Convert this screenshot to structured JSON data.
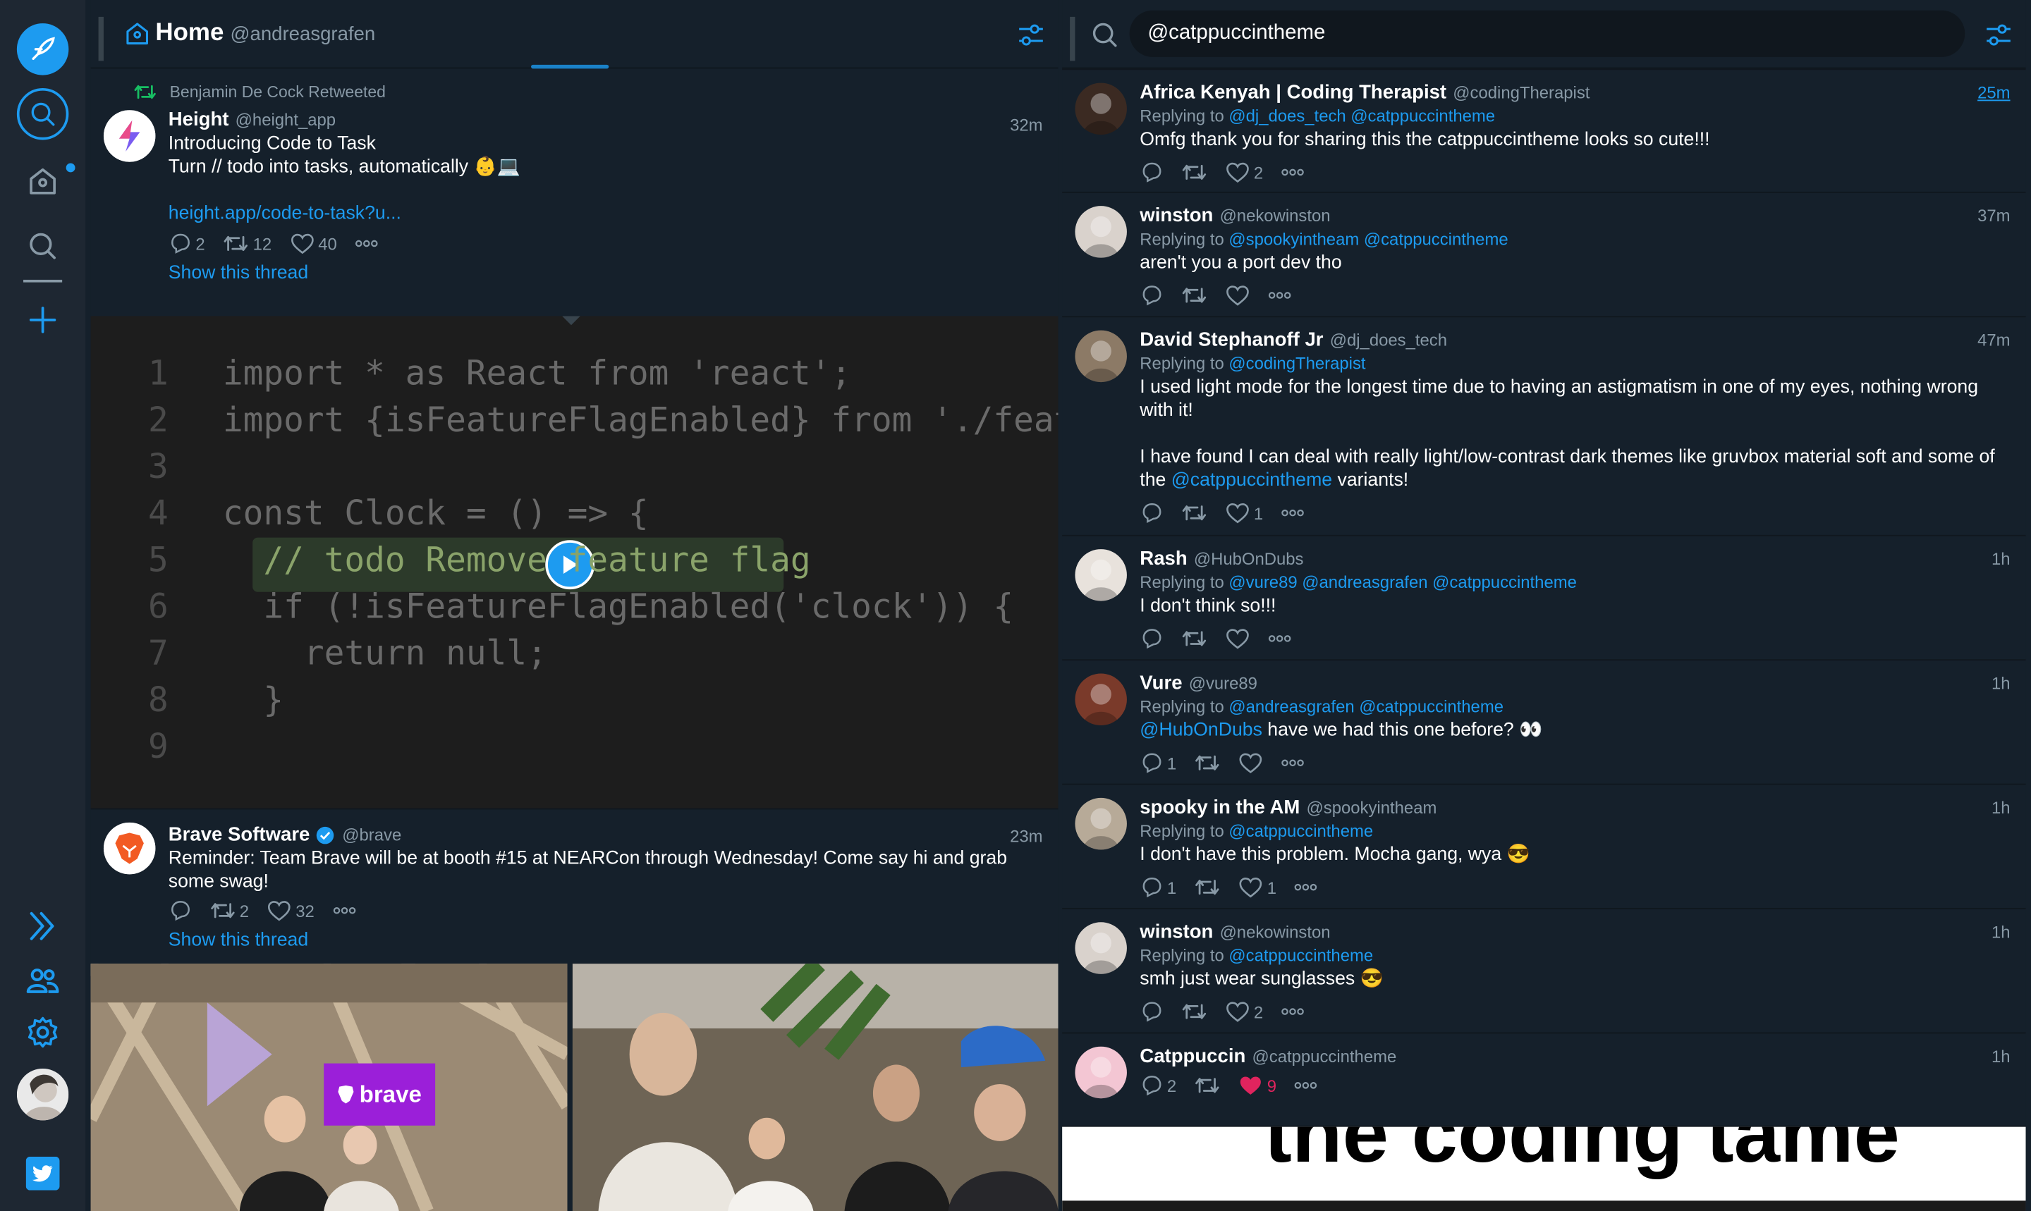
{
  "sidebar": {
    "icons": [
      "compose-icon",
      "search-icon",
      "home-icon",
      "search-icon",
      "plus-icon",
      "expand-icon",
      "people-icon",
      "gear-icon",
      "avatar",
      "twitter-icon"
    ]
  },
  "column1": {
    "number": "1",
    "title": "Home",
    "handle": "@andreasgrafen",
    "tweet1": {
      "retweeted_by": "Benjamin De Cock Retweeted",
      "name": "Height",
      "handle": "@height_app",
      "time": "32m",
      "line1": "Introducing Code to Task",
      "line2": "Turn // todo into tasks, automatically 👶💻",
      "link": "height.app/code-to-task?u...",
      "replies": "2",
      "retweets": "12",
      "likes": "40",
      "show_thread": "Show this thread"
    },
    "code": [
      {
        "n": "1",
        "t": "import * as React from 'react';"
      },
      {
        "n": "2",
        "t": "import {isFeatureFlagEnabled} from './featu"
      },
      {
        "n": "3",
        "t": ""
      },
      {
        "n": "4",
        "t": "const Clock = () => {"
      },
      {
        "n": "5",
        "t": "  // todo Remove feature flag"
      },
      {
        "n": "6",
        "t": "  if (!isFeatureFlagEnabled('clock')) {"
      },
      {
        "n": "7",
        "t": "    return null;"
      },
      {
        "n": "8",
        "t": "  }"
      },
      {
        "n": "9",
        "t": ""
      }
    ],
    "tweet2": {
      "name": "Brave Software",
      "handle": "@brave",
      "time": "23m",
      "text": "Reminder: Team Brave will be at booth #15 at NEARCon through Wednesday! Come say hi and grab some swag!",
      "retweets": "2",
      "likes": "32",
      "show_thread": "Show this thread",
      "badge": "brave"
    }
  },
  "column2": {
    "number": "2",
    "search_value": "@catppuccintheme",
    "tweets": [
      {
        "name": "Africa Kenyah | Coding Therapist",
        "handle": "@codingTherapist",
        "time": "25m",
        "reply_prefix": "Replying to ",
        "reply_to": "@dj_does_tech @catppuccintheme",
        "text": "Omfg thank you for sharing this the catppuccintheme looks so cute!!!",
        "replies": "",
        "retweets": "",
        "likes": "2"
      },
      {
        "name": "winston",
        "handle": "@nekowinston",
        "time": "37m",
        "reply_prefix": "Replying to ",
        "reply_to": "@spookyintheam @catppuccintheme",
        "text": "aren't you a port dev tho",
        "replies": "",
        "retweets": "",
        "likes": ""
      },
      {
        "name": "David Stephanoff Jr",
        "handle": "@dj_does_tech",
        "time": "47m",
        "reply_prefix": "Replying to ",
        "reply_to": "@codingTherapist",
        "text1": "I used light mode for the longest time due to having an astigmatism in one of my eyes, nothing wrong with it!",
        "text2": "I have found I can deal with really light/low-contrast dark themes like gruvbox material soft and some of the ",
        "text2_mention": "@catppuccintheme",
        "text2_end": " variants!",
        "replies": "",
        "retweets": "",
        "likes": "1"
      },
      {
        "name": "Rash",
        "handle": "@HubOnDubs",
        "time": "1h",
        "reply_prefix": "Replying to ",
        "reply_to": "@vure89 @andreasgrafen @catppuccintheme",
        "text": "I don't think so!!!",
        "replies": "",
        "retweets": "",
        "likes": ""
      },
      {
        "name": "Vure",
        "handle": "@vure89",
        "time": "1h",
        "reply_prefix": "Replying to ",
        "reply_to": "@andreasgrafen @catppuccintheme",
        "text_mention": "@HubOnDubs",
        "text": " have we had this one before? 👀",
        "replies": "1",
        "retweets": "",
        "likes": ""
      },
      {
        "name": "spooky in the AM",
        "handle": "@spookyintheam",
        "time": "1h",
        "reply_prefix": "Replying to ",
        "reply_to": "@catppuccintheme",
        "text": "I don't have this problem. Mocha gang, wya 😎",
        "replies": "1",
        "retweets": "",
        "likes": "1"
      },
      {
        "name": "winston",
        "handle": "@nekowinston",
        "time": "1h",
        "reply_prefix": "Replying to ",
        "reply_to": "@catppuccintheme",
        "text": "smh just wear sunglasses 😎",
        "replies": "",
        "retweets": "",
        "likes": "2"
      },
      {
        "name": "Catppuccin",
        "handle": "@catppuccintheme",
        "time": "1h",
        "replies": "2",
        "retweets": "",
        "likes": "9"
      }
    ],
    "bottom_image_text": "the coding tame"
  },
  "colors": {
    "bg": "#15202b",
    "sidebar": "#1e2732",
    "accent": "#1d9bf0",
    "muted": "#8899a6",
    "like": "#e0245e"
  }
}
